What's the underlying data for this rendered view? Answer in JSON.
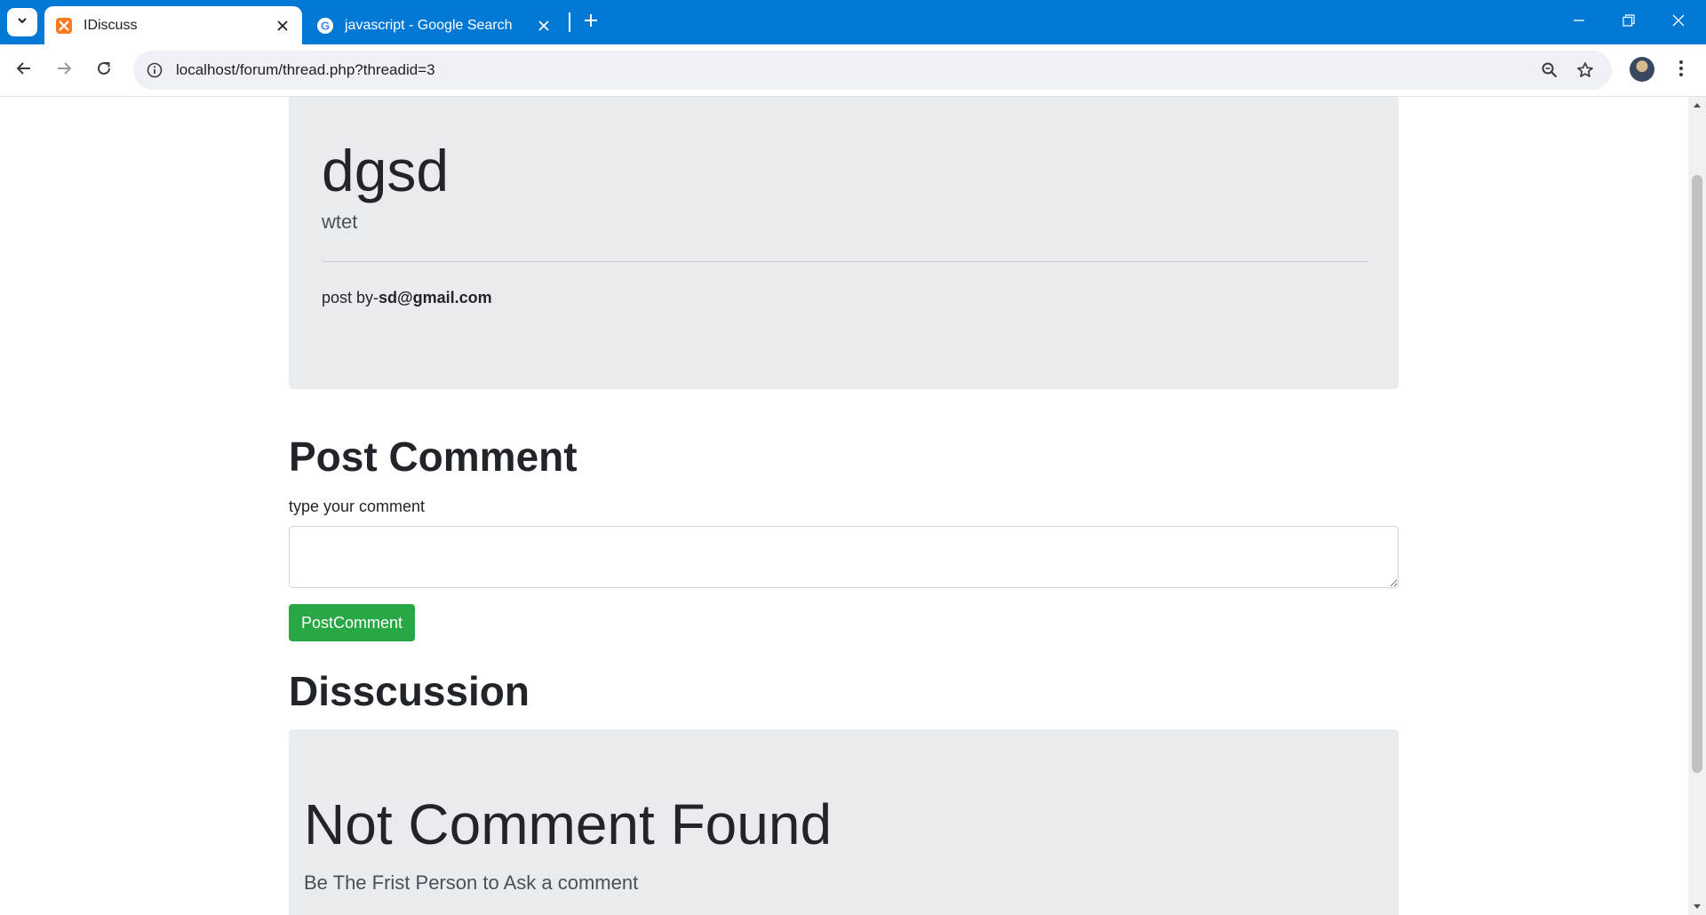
{
  "browser": {
    "tabs": [
      {
        "title": "IDiscuss",
        "active": true,
        "favicon": "xampp-icon"
      },
      {
        "title": "javascript - Google Search",
        "active": false,
        "favicon": "google-icon"
      }
    ],
    "url": "localhost/forum/thread.php?threadid=3",
    "accent_color": "#0078d4"
  },
  "thread": {
    "title": "dgsd",
    "description": "wtet",
    "author_prefix": "post by-",
    "author_email": "sd@gmail.com"
  },
  "comment_form": {
    "heading": "Post Comment",
    "label": "type your comment",
    "textarea_value": "",
    "button_label": "PostComment",
    "button_color": "#28a745"
  },
  "discussion": {
    "heading": "Disscussion",
    "empty_title": "Not Comment Found",
    "empty_subtitle": "Be The Frist Person to Ask a comment"
  }
}
